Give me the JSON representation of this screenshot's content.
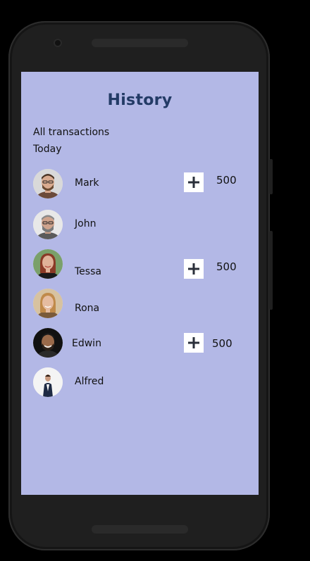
{
  "screen": {
    "title": "History",
    "subtitle": "All transactions",
    "section": "Today"
  },
  "transactions": [
    {
      "name": "Mark",
      "amount": "500",
      "avatar": "avatar-mark"
    },
    {
      "name": "John",
      "amount": "",
      "avatar": "avatar-john"
    },
    {
      "name": "Tessa",
      "amount": "500",
      "avatar": "avatar-tessa"
    },
    {
      "name": "Rona",
      "amount": "",
      "avatar": "avatar-rona"
    },
    {
      "name": "Edwin",
      "amount": "500",
      "avatar": "avatar-edwin"
    },
    {
      "name": "Alfred",
      "amount": "",
      "avatar": "avatar-alfred"
    }
  ],
  "colors": {
    "screen_bg": "#b3b8e6",
    "title": "#233b66",
    "frame": "#1f1f1f"
  }
}
